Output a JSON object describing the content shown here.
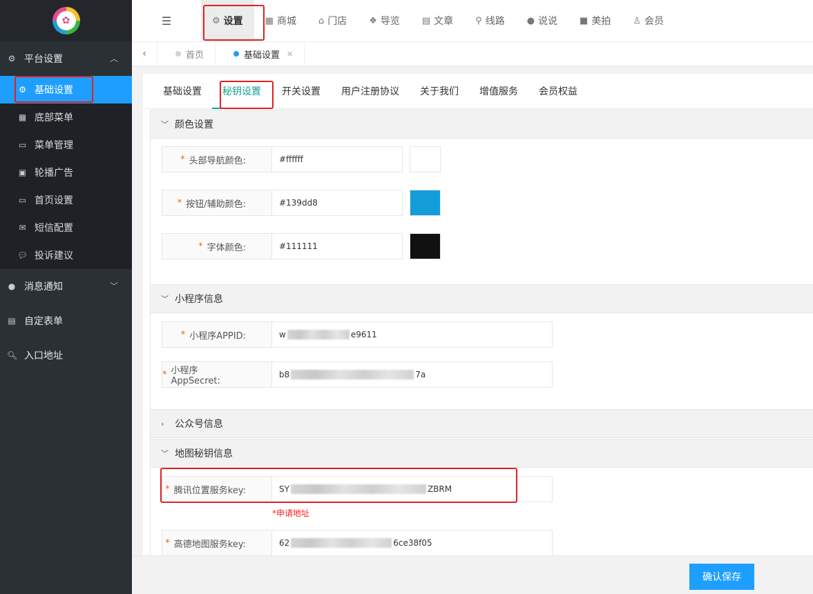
{
  "sidebar": {
    "groups": [
      {
        "label": "平台设置",
        "icon": "gear-icon"
      },
      {
        "label": "消息通知",
        "icon": "chat-icon"
      },
      {
        "label": "自定表单",
        "icon": "form-icon"
      },
      {
        "label": "入口地址",
        "icon": "search-icon"
      }
    ],
    "items": [
      {
        "label": "基础设置",
        "icon": "gear-icon"
      },
      {
        "label": "底部菜单",
        "icon": "grid-icon"
      },
      {
        "label": "菜单管理",
        "icon": "monitor-icon"
      },
      {
        "label": "轮播广告",
        "icon": "image-icon"
      },
      {
        "label": "首页设置",
        "icon": "monitor-icon"
      },
      {
        "label": "短信配置",
        "icon": "mail-icon"
      },
      {
        "label": "投诉建议",
        "icon": "chat-icon"
      }
    ]
  },
  "topnav": [
    {
      "label": "设置",
      "icon": "gears-icon"
    },
    {
      "label": "商城",
      "icon": "shop-icon"
    },
    {
      "label": "门店",
      "icon": "bank-icon"
    },
    {
      "label": "导览",
      "icon": "cubes-icon"
    },
    {
      "label": "文章",
      "icon": "newspaper-icon"
    },
    {
      "label": "线路",
      "icon": "road-icon"
    },
    {
      "label": "说说",
      "icon": "wechat-icon"
    },
    {
      "label": "美拍",
      "icon": "video-icon"
    },
    {
      "label": "会员",
      "icon": "user-icon"
    }
  ],
  "pagetabs": [
    {
      "label": "首页"
    },
    {
      "label": "基础设置"
    }
  ],
  "subtabs": [
    "基础设置",
    "秘钥设置",
    "开关设置",
    "用户注册协议",
    "关于我们",
    "增值服务",
    "会员权益"
  ],
  "sections": {
    "color": {
      "title": "颜色设置",
      "fields": [
        {
          "label": "头部导航颜色:",
          "value": "#ffffff",
          "swatch": "#ffffff"
        },
        {
          "label": "按钮/辅助颜色:",
          "value": "#139dd8",
          "swatch": "#139dd8"
        },
        {
          "label": "字体颜色:",
          "value": "#111111",
          "swatch": "#111111"
        }
      ]
    },
    "mini": {
      "title": "小程序信息",
      "fields": [
        {
          "label": "小程序APPID:",
          "prefix": "w",
          "suffix": "e9611"
        },
        {
          "label": "小程序AppSecret:",
          "prefix": "b8",
          "suffix": "7a"
        }
      ]
    },
    "official": {
      "title": "公众号信息"
    },
    "map": {
      "title": "地图秘钥信息",
      "fields": [
        {
          "label": "腾讯位置服务key:",
          "prefix": "SY",
          "suffix": "ZBRM"
        },
        {
          "label": "高德地图服务key:",
          "prefix": "62",
          "suffix": "6ce38f05"
        }
      ],
      "apply_link": "*申请地址"
    }
  },
  "required_mark": "*",
  "footer": {
    "save_label": "确认保存"
  },
  "colors": {
    "accent": "#1e9fff",
    "active_tab": "#1aa094",
    "highlight": "#e02020"
  }
}
